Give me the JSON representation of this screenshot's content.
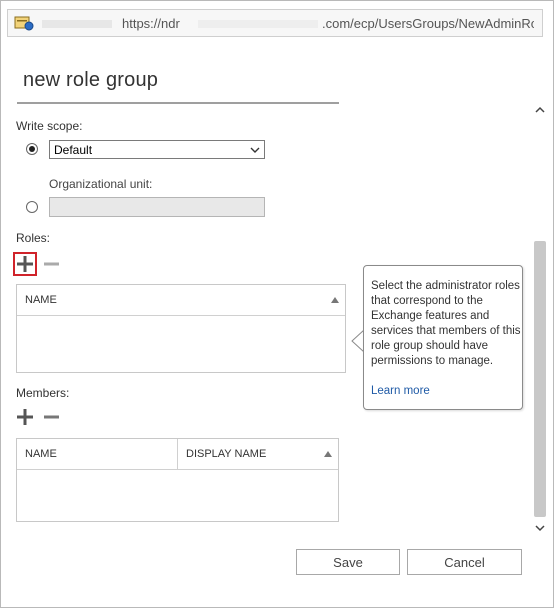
{
  "address_bar": {
    "url_host": "https://ndr",
    "url_path": ".com/ecp/UsersGroups/NewAdminRole"
  },
  "dialog": {
    "title": "new role group",
    "write_scope": {
      "label": "Write scope:",
      "selected": "Default",
      "ou_label": "Organizational unit:",
      "ou_value": ""
    },
    "roles": {
      "label": "Roles:",
      "columns": [
        "NAME"
      ],
      "rows": []
    },
    "members": {
      "label": "Members:",
      "columns": [
        "NAME",
        "DISPLAY NAME"
      ],
      "rows": []
    },
    "callout": {
      "text": "Select the administrator roles that correspond to the Exchange features and services that members of this role group should have permissions to manage.",
      "link": "Learn more"
    },
    "buttons": {
      "save": "Save",
      "cancel": "Cancel"
    }
  },
  "colors": {
    "link": "#1f5aa6",
    "highlight": "#d0232a",
    "scroll_thumb": "#c8c8c8"
  },
  "icons": [
    "site-icon",
    "add-icon",
    "remove-icon",
    "chevron-down-icon",
    "sort-ascending-icon",
    "scroll-up-icon",
    "scroll-down-icon"
  ]
}
